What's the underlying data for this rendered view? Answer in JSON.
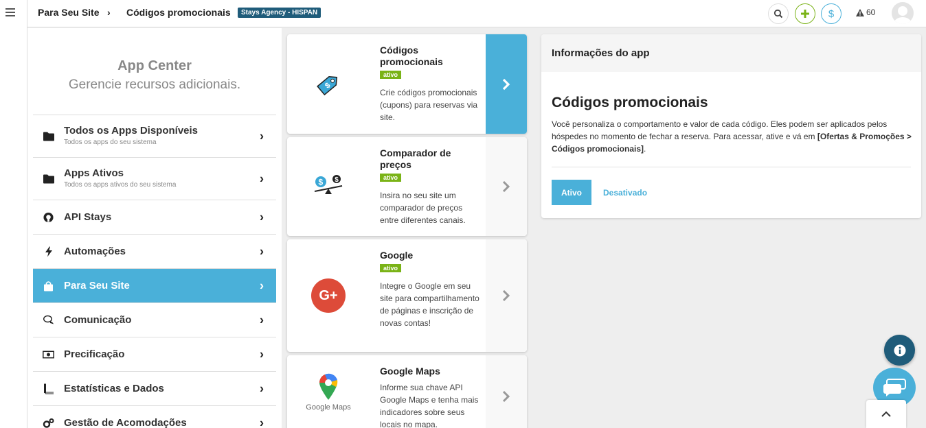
{
  "topbar": {
    "crumb_1": "Para Seu Site",
    "crumb_sep": "›",
    "crumb_2": "Códigos promocionais",
    "agency_badge": "Stays Agency - HISPAN",
    "alerts_count": "60"
  },
  "sidebar": {
    "title": "App Center",
    "subtitle": "Gerencie recursos adicionais.",
    "items": [
      {
        "label": "Todos os Apps Disponíveis",
        "desc": "Todos os apps do seu sistema",
        "icon": "folder-icon"
      },
      {
        "label": "Apps Ativos",
        "desc": "Todos os apps ativos do seu sistema",
        "icon": "folder-icon"
      },
      {
        "label": "API Stays",
        "icon": "github-icon"
      },
      {
        "label": "Automações",
        "icon": "bolt-icon"
      },
      {
        "label": "Para Seu Site",
        "icon": "shopping-bag-icon",
        "active": true
      },
      {
        "label": "Comunicação",
        "icon": "chat-bubbles-icon"
      },
      {
        "label": "Precificação",
        "icon": "money-bill-icon"
      },
      {
        "label": "Estatísticas e Dados",
        "icon": "book-icon"
      },
      {
        "label": "Gestão de Acomodações",
        "icon": "gears-icon"
      }
    ]
  },
  "cards": [
    {
      "title": "Códigos promocionais",
      "badge": "ativo",
      "desc": "Crie códigos promocionais (cupons) para reservas via site.",
      "icon": "promo-tag-icon"
    },
    {
      "title": "Comparador de preços",
      "badge": "ativo",
      "desc": "Insira no seu site um comparador de preços entre diferentes canais.",
      "icon": "price-scale-icon"
    },
    {
      "title": "Google",
      "badge": "ativo",
      "desc": "Integre o Google em seu site para compartilhamento de páginas e inscrição de novas contas!",
      "icon": "google-plus-icon",
      "icon_text": "G+"
    },
    {
      "title": "Google Maps",
      "desc": "Informe sua chave API Google Maps e tenha mais indicadores sobre seus locais no mapa.",
      "icon": "google-maps-icon",
      "icon_text": "Google Maps"
    }
  ],
  "info": {
    "header": "Informações do app",
    "title": "Códigos promocionais",
    "text_plain": "Você personaliza o comportamento e valor de cada código. Eles podem ser aplicados pelos hóspedes no momento de fechar a reserva. Para acessar, ative e vá em ",
    "text_bold": "[Ofertas & Promoções > Códigos promocionais]",
    "text_end": ".",
    "btn_active": "Ativo",
    "btn_off": "Desativado"
  },
  "colors": {
    "accent": "#4ab0d9",
    "brand_dark": "#1f5c7a",
    "badge_green": "#7ab317",
    "google_red": "#dd4b39"
  }
}
